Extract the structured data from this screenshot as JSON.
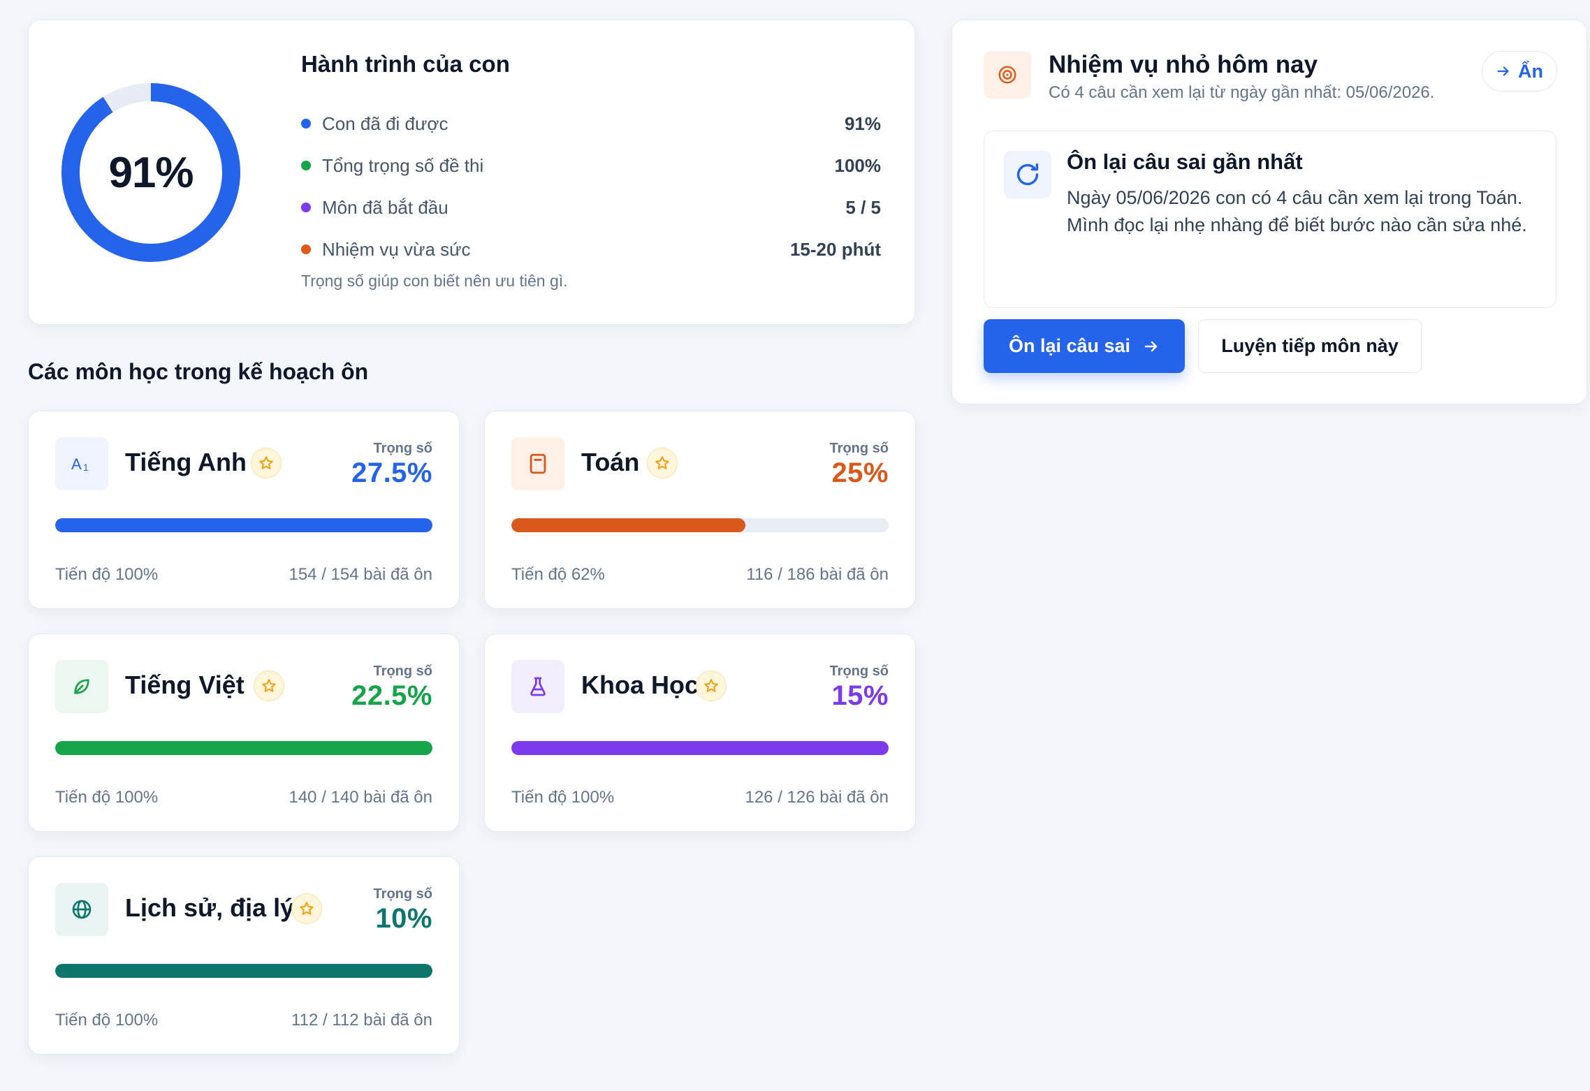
{
  "journey": {
    "percent_label": "91%",
    "percent_value": 0.91,
    "title": "Hành trình của con",
    "stats": [
      {
        "label": "Con đã đi được",
        "value": "91%",
        "color": "#2563eb"
      },
      {
        "label": "Tổng trọng số đề thi",
        "value": "100%",
        "color": "#16a34a"
      },
      {
        "label": "Môn đã bắt đầu",
        "value": "5 / 5",
        "color": "#7c3aed"
      },
      {
        "label": "Nhiệm vụ vừa sức",
        "value": "15-20 phút",
        "color": "#e05a1c"
      }
    ],
    "note": "Trọng số giúp con biết nên ưu tiên gì."
  },
  "section_title": "Các môn học trong kế hoạch ôn",
  "subjects": [
    {
      "name": "Tiếng Anh",
      "icon": "language-icon",
      "weight_label": "Trọng số",
      "weight": "27.5%",
      "progress_label": "Tiến độ 100%",
      "progress": 1.0,
      "lessons": "154 / 154 bài đã ôn",
      "color": "#2563eb",
      "icon_bg": "#eef3fd"
    },
    {
      "name": "Toán",
      "icon": "book-icon",
      "weight_label": "Trọng số",
      "weight": "25%",
      "progress_label": "Tiến độ 62%",
      "progress": 0.62,
      "lessons": "116 / 186 bài đã ôn",
      "color": "#d9581c",
      "icon_bg": "#fff1e8"
    },
    {
      "name": "Tiếng Việt",
      "icon": "leaf-icon",
      "weight_label": "Trọng số",
      "weight": "22.5%",
      "progress_label": "Tiến độ 100%",
      "progress": 1.0,
      "lessons": "140 / 140 bài đã ôn",
      "color": "#16a34a",
      "icon_bg": "#ebf7ef"
    },
    {
      "name": "Khoa Học",
      "icon": "flask-icon",
      "weight_label": "Trọng số",
      "weight": "15%",
      "progress_label": "Tiến độ 100%",
      "progress": 1.0,
      "lessons": "126 / 126 bài đã ôn",
      "color": "#7c3aed",
      "icon_bg": "#f3eefe"
    },
    {
      "name": "Lịch sử, địa lý",
      "icon": "globe-icon",
      "weight_label": "Trọng số",
      "weight": "10%",
      "progress_label": "Tiến độ 100%",
      "progress": 1.0,
      "lessons": "112 / 112 bài đã ôn",
      "color": "#0f766e",
      "icon_bg": "#e8f5f2"
    }
  ],
  "mission": {
    "title": "Nhiệm vụ nhỏ hôm nay",
    "subtitle": "Có 4 câu cần xem lại từ ngày gần nhất: 05/06/2026.",
    "hide_label": "Ẩn",
    "review_title": "Ôn lại câu sai gần nhất",
    "review_body": "Ngày 05/06/2026 con có 4 câu cần xem lại trong Toán. Mình đọc lại nhẹ nhàng để biết bước nào cần sửa nhé.",
    "primary_label": "Ôn lại câu sai",
    "secondary_label": "Luyện tiếp môn này"
  },
  "colors": {
    "accent": "#2563eb",
    "star": "#f59e0b",
    "mission_icon": "#e05a1c"
  }
}
